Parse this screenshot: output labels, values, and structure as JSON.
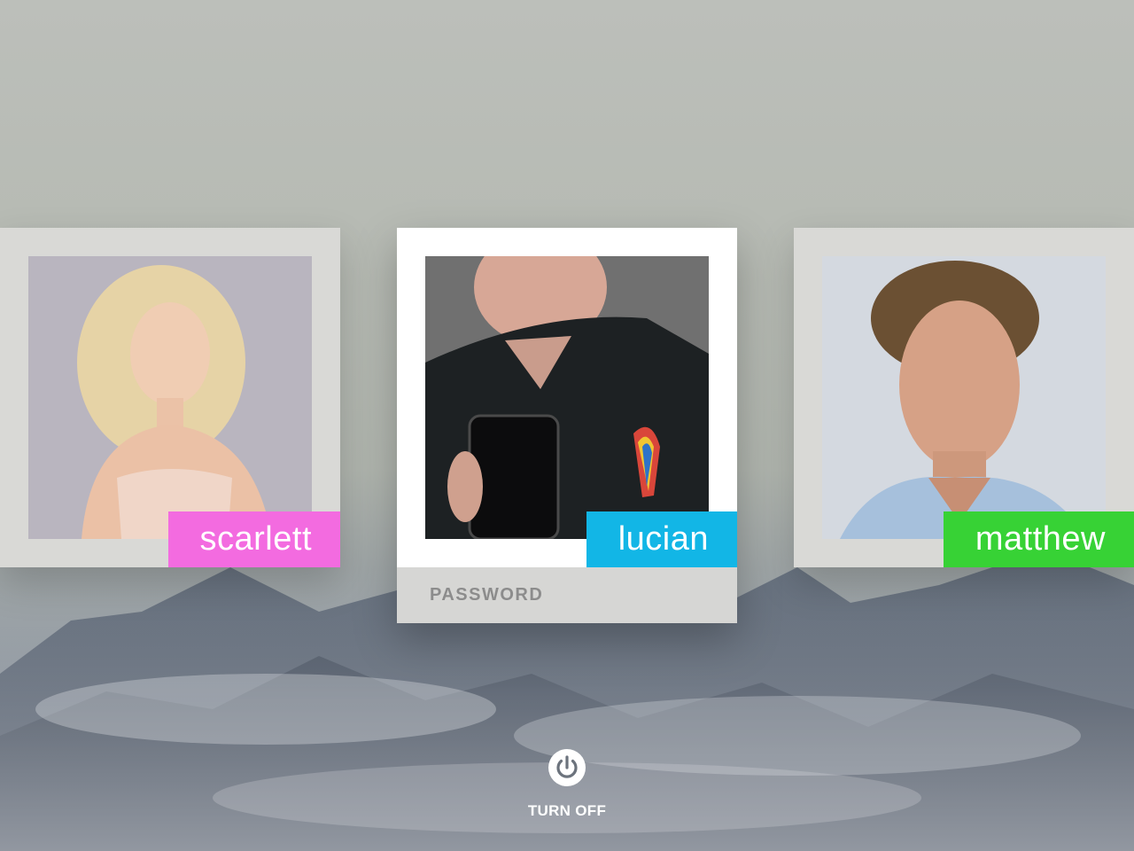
{
  "users": [
    {
      "name": "scarlett",
      "tag_color": "#f36be0",
      "active": false
    },
    {
      "name": "lucian",
      "tag_color": "#12b6e6",
      "active": true
    },
    {
      "name": "matthew",
      "tag_color": "#37d235",
      "active": false
    }
  ],
  "login": {
    "password_placeholder": "PASSWORD"
  },
  "power": {
    "icon": "power-icon",
    "label": "TURN OFF"
  }
}
